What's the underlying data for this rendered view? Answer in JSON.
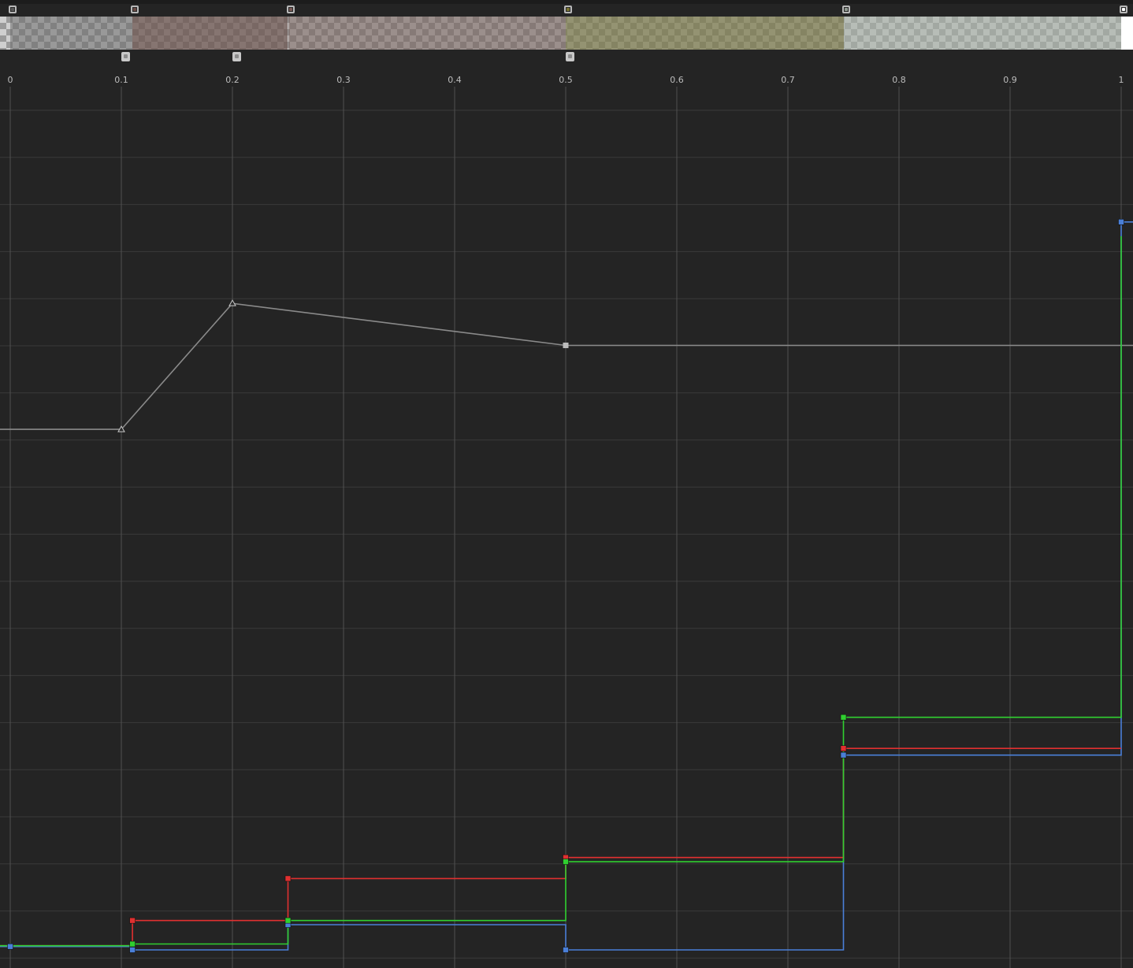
{
  "color_stops_bar": {
    "segments": [
      {
        "from": 0.0,
        "to": 0.11,
        "color": "#6e6e6e",
        "alpha": 0.55
      },
      {
        "from": 0.11,
        "to": 0.25,
        "color": "#6d5751",
        "alpha": 0.75
      },
      {
        "from": 0.25,
        "to": 0.5,
        "color": "#7b6763",
        "alpha": 0.62
      },
      {
        "from": 0.5,
        "to": 0.75,
        "color": "#7d7c4e",
        "alpha": 0.72
      },
      {
        "from": 0.75,
        "to": 1.0,
        "color": "#a8b2a8",
        "alpha": 0.62
      },
      {
        "from": 1.0,
        "to": 1.02,
        "color": "#ffffff",
        "alpha": 1.0
      }
    ],
    "color_stops": [
      {
        "time": 0.0,
        "color": "#5a5a5a"
      },
      {
        "time": 0.11,
        "color": "#6a4a44"
      },
      {
        "time": 0.25,
        "color": "#7a5a56"
      },
      {
        "time": 0.5,
        "color": "#7a7430"
      },
      {
        "time": 0.75,
        "color": "#909a90"
      },
      {
        "time": 1.0,
        "color": "#ffffff"
      }
    ],
    "alpha_stops": [
      {
        "time": 0.1
      },
      {
        "time": 0.2
      },
      {
        "time": 0.5
      }
    ]
  },
  "chart_data": {
    "type": "line",
    "x_ticks": [
      "0",
      "0.1",
      "0.2",
      "0.3",
      "0.4",
      "0.5",
      "0.6",
      "0.7",
      "0.8",
      "0.9",
      "1"
    ],
    "xlim": [
      0,
      1
    ],
    "grid": true,
    "colors": {
      "background": "#242424",
      "grid": "#3a3a3a",
      "grid_vertical": "#505050",
      "alpha": "#8a8a8a",
      "red": "#e03030",
      "green": "#30d030",
      "blue": "#4a7fd8"
    },
    "series": [
      {
        "key": "alpha",
        "interp": "linear",
        "points": [
          [
            -0.02,
            0.62
          ],
          [
            0.1,
            0.62
          ],
          [
            0.2,
            0.77
          ],
          [
            0.5,
            0.72
          ],
          [
            1.02,
            0.72
          ]
        ],
        "keys": [
          [
            0.1,
            0.62,
            "triangle"
          ],
          [
            0.2,
            0.77,
            "triangle"
          ],
          [
            0.5,
            0.72,
            "square"
          ]
        ]
      },
      {
        "key": "red",
        "interp": "step",
        "points": [
          [
            -0.02,
            0.005
          ],
          [
            0.11,
            0.005
          ],
          [
            0.11,
            0.035
          ],
          [
            0.25,
            0.035
          ],
          [
            0.25,
            0.085
          ],
          [
            0.5,
            0.085
          ],
          [
            0.5,
            0.11
          ],
          [
            0.75,
            0.11
          ],
          [
            0.75,
            0.24
          ],
          [
            1.0,
            0.24
          ]
        ],
        "keys": [
          [
            0.11,
            0.035
          ],
          [
            0.25,
            0.085
          ],
          [
            0.5,
            0.11
          ],
          [
            0.75,
            0.24
          ]
        ]
      },
      {
        "key": "green",
        "interp": "step",
        "points": [
          [
            -0.02,
            0.005
          ],
          [
            0.11,
            0.005
          ],
          [
            0.11,
            0.007
          ],
          [
            0.25,
            0.007
          ],
          [
            0.25,
            0.035
          ],
          [
            0.5,
            0.035
          ],
          [
            0.5,
            0.105
          ],
          [
            0.75,
            0.105
          ],
          [
            0.75,
            0.277
          ],
          [
            1.0,
            0.277
          ],
          [
            1.0,
            0.85
          ]
        ],
        "keys": [
          [
            0.11,
            0.007
          ],
          [
            0.25,
            0.035
          ],
          [
            0.5,
            0.105
          ],
          [
            0.75,
            0.277
          ]
        ]
      },
      {
        "key": "blue",
        "interp": "step",
        "points": [
          [
            -0.02,
            0.004
          ],
          [
            0.11,
            0.004
          ],
          [
            0.11,
            0.0
          ],
          [
            0.25,
            0.0
          ],
          [
            0.25,
            0.03
          ],
          [
            0.5,
            0.03
          ],
          [
            0.5,
            0.0
          ],
          [
            0.75,
            0.0
          ],
          [
            0.75,
            0.232
          ],
          [
            1.0,
            0.232
          ],
          [
            1.0,
            0.867
          ],
          [
            1.02,
            0.867
          ]
        ],
        "keys": [
          [
            0.0,
            0.004
          ],
          [
            0.11,
            0.0
          ],
          [
            0.25,
            0.03
          ],
          [
            0.5,
            0.0
          ],
          [
            0.75,
            0.232
          ],
          [
            1.0,
            0.867
          ]
        ]
      }
    ]
  }
}
